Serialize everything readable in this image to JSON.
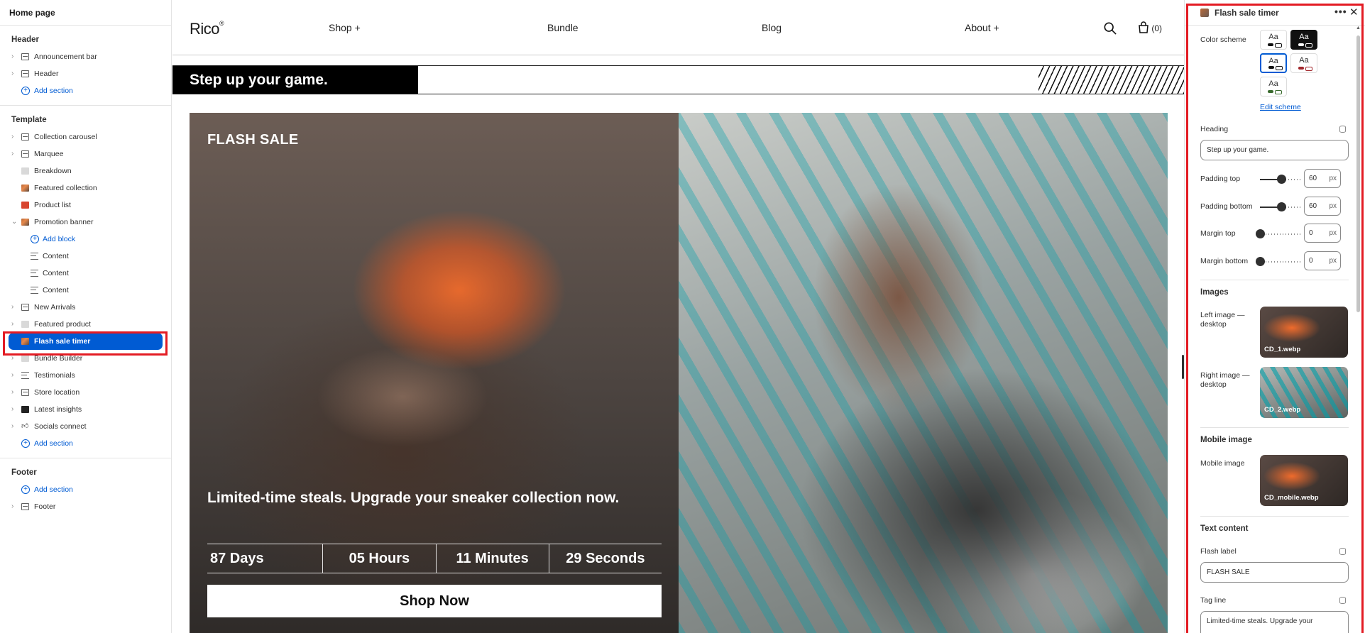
{
  "left_panel": {
    "page_title": "Home page",
    "header_group": {
      "title": "Header",
      "items": [
        "Announcement bar",
        "Header"
      ],
      "add_label": "Add section"
    },
    "template_group": {
      "title": "Template",
      "items": {
        "collection_carousel": "Collection carousel",
        "marquee": "Marquee",
        "breakdown": "Breakdown",
        "featured_collection": "Featured collection",
        "product_list": "Product list",
        "promotion_banner": "Promotion banner",
        "add_block": "Add block",
        "content_1": "Content",
        "content_2": "Content",
        "content_3": "Content",
        "new_arrivals": "New Arrivals",
        "featured_product": "Featured product",
        "flash_sale_timer": "Flash sale timer",
        "bundle_builder": "Bundle Builder",
        "testimonials": "Testimonials",
        "store_location": "Store location",
        "latest_insights": "Latest insights",
        "socials_connect": "Socials connect"
      },
      "add_label": "Add section"
    },
    "footer_group": {
      "title": "Footer",
      "add_label": "Add section",
      "items": [
        "Footer"
      ]
    }
  },
  "preview": {
    "logo": "Rico",
    "logo_mark": "®",
    "nav": {
      "shop": "Shop +",
      "bundle": "Bundle",
      "blog": "Blog",
      "about": "About +"
    },
    "cart_count": "(0)",
    "tag_heading": "Step up your game.",
    "flash_label": "FLASH SALE",
    "tagline": "Limited-time steals. Upgrade your sneaker collection now.",
    "timer": {
      "days": "87 Days",
      "hours": "05 Hours",
      "minutes": "11 Minutes",
      "seconds": "29 Seconds"
    },
    "cta": "Shop Now"
  },
  "right_panel": {
    "title": "Flash sale timer",
    "more": "•••",
    "close": "✕",
    "color_scheme_label": "Color scheme",
    "swatch_text": "Aa",
    "edit_scheme": "Edit scheme",
    "heading_label": "Heading",
    "heading_value": "Step up your game.",
    "padding_top_label": "Padding top",
    "padding_top_value": "60",
    "padding_bottom_label": "Padding bottom",
    "padding_bottom_value": "60",
    "margin_top_label": "Margin top",
    "margin_top_value": "0",
    "margin_bottom_label": "Margin bottom",
    "margin_bottom_value": "0",
    "unit": "px",
    "padding_top_level": 0.5,
    "padding_bottom_level": 0.5,
    "margin_top_level": 0,
    "margin_bottom_level": 0,
    "images_title": "Images",
    "left_image_label": "Left image — desktop",
    "left_image_file": "CD_1.webp",
    "right_image_label": "Right image — desktop",
    "right_image_file": "CD_2.webp",
    "mobile_title": "Mobile image",
    "mobile_image_label": "Mobile image",
    "mobile_image_file": "CD_mobile.webp",
    "text_content_title": "Text content",
    "flash_label_label": "Flash label",
    "flash_label_value": "FLASH SALE",
    "tag_line_label": "Tag line",
    "tag_line_value": "Limited-time steals. Upgrade your"
  },
  "colors": {
    "selected_blue": "#005bd3",
    "highlight_red": "#e31b23",
    "link_blue": "#005bd3"
  }
}
